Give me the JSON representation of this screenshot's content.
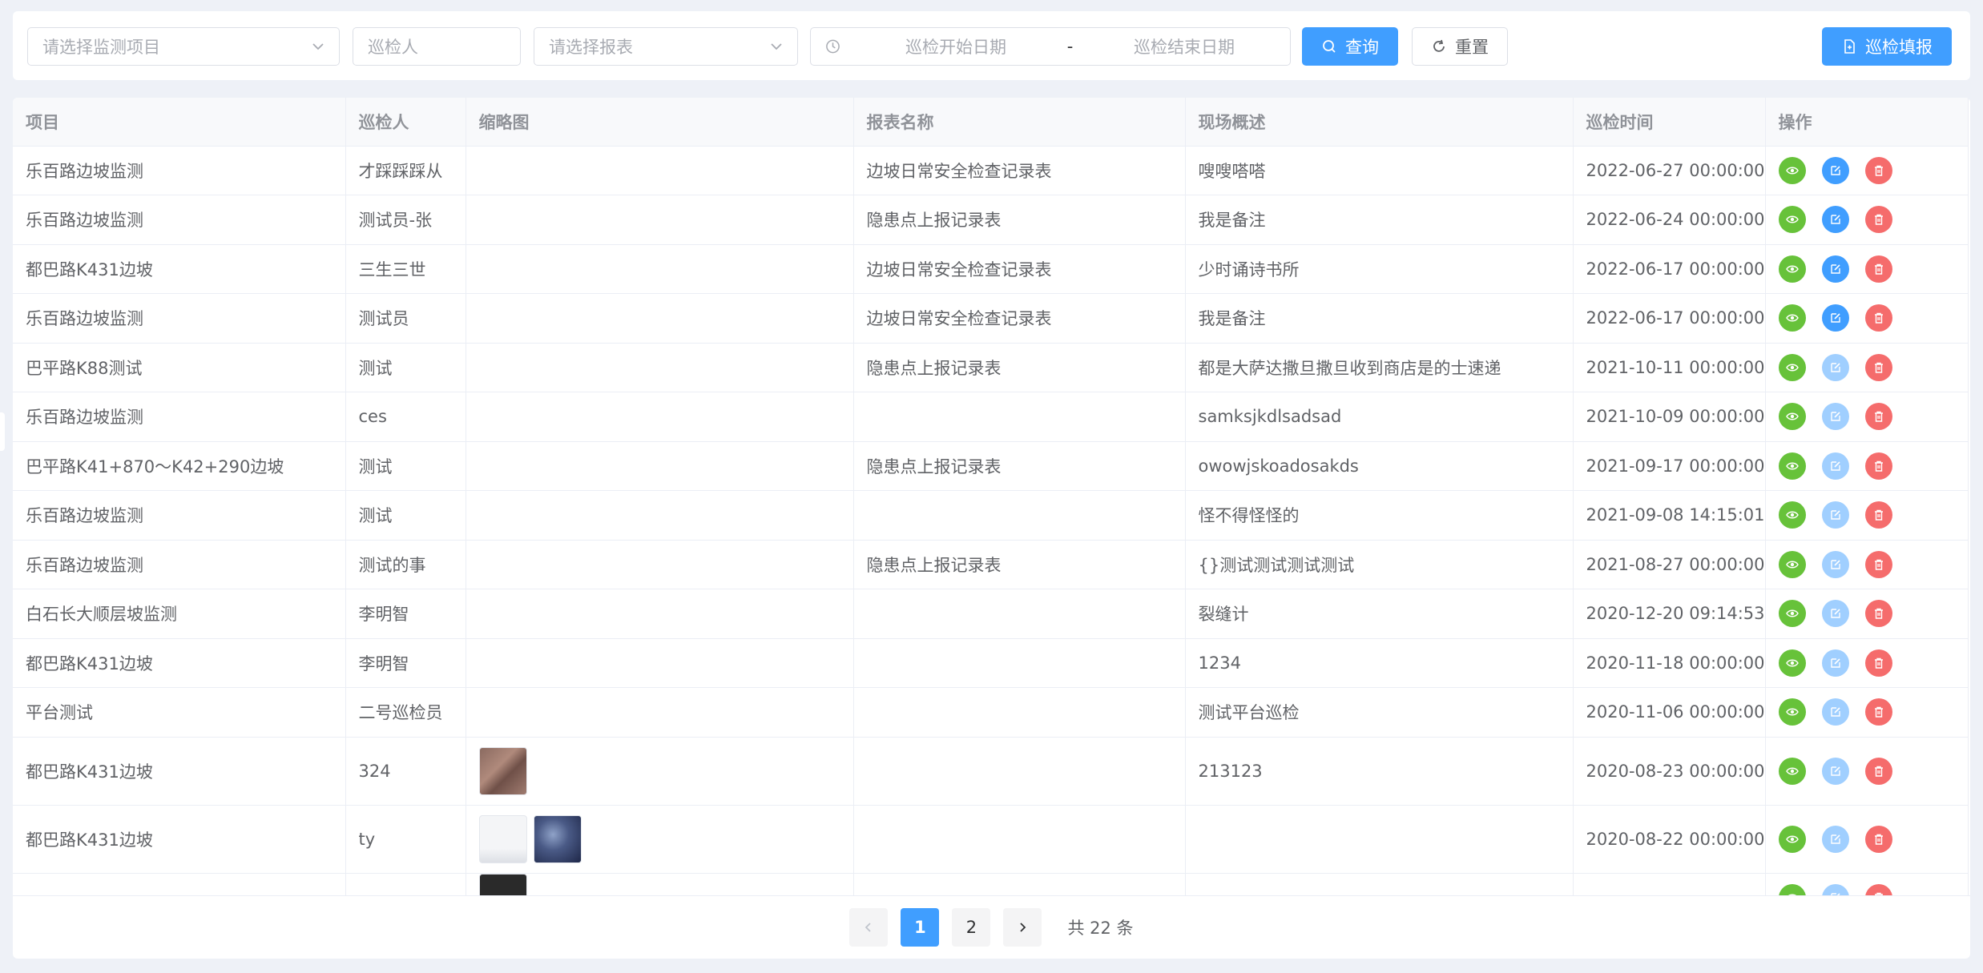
{
  "filters": {
    "project_placeholder": "请选择监测项目",
    "inspector_placeholder": "巡检人",
    "report_placeholder": "请选择报表",
    "start_date_placeholder": "巡检开始日期",
    "date_separator": "-",
    "end_date_placeholder": "巡检结束日期",
    "query_label": "查询",
    "reset_label": "重置",
    "fill_label": "巡检填报"
  },
  "table": {
    "columns": [
      "项目",
      "巡检人",
      "缩略图",
      "报表名称",
      "现场概述",
      "巡检时间",
      "操作"
    ],
    "rows": [
      {
        "project": "乐百路边坡监测",
        "inspector": "才踩踩踩从",
        "report": "边坡日常安全检查记录表",
        "summary": "嗖嗖嗒嗒",
        "time": "2022-06-27 00:00:00",
        "editable": true
      },
      {
        "project": "乐百路边坡监测",
        "inspector": "测试员-张",
        "report": "隐患点上报记录表",
        "summary": "我是备注",
        "time": "2022-06-24 00:00:00",
        "editable": true
      },
      {
        "project": "都巴路K431边坡",
        "inspector": "三生三世",
        "report": "边坡日常安全检查记录表",
        "summary": "少时诵诗书所",
        "time": "2022-06-17 00:00:00",
        "editable": true
      },
      {
        "project": "乐百路边坡监测",
        "inspector": "测试员",
        "report": "边坡日常安全检查记录表",
        "summary": "我是备注",
        "time": "2022-06-17 00:00:00",
        "editable": true
      },
      {
        "project": "巴平路K88测试",
        "inspector": "测试",
        "report": "隐患点上报记录表",
        "summary": "都是大萨达撒旦撒旦收到商店是的士速递",
        "time": "2021-10-11 00:00:00",
        "editable": false
      },
      {
        "project": "乐百路边坡监测",
        "inspector": "ces",
        "report": "",
        "summary": "samksjkdlsadsad",
        "time": "2021-10-09 00:00:00",
        "editable": false
      },
      {
        "project": "巴平路K41+870～K42+290边坡",
        "inspector": "测试",
        "report": "隐患点上报记录表",
        "summary": "owowjskoadosakds",
        "time": "2021-09-17 00:00:00",
        "editable": false
      },
      {
        "project": "乐百路边坡监测",
        "inspector": "测试",
        "report": "",
        "summary": "怪不得怪怪的",
        "time": "2021-09-08 14:15:01",
        "editable": false
      },
      {
        "project": "乐百路边坡监测",
        "inspector": "测试的事",
        "report": "隐患点上报记录表",
        "summary": "{}测试测试测试测试",
        "time": "2021-08-27 00:00:00",
        "editable": false
      },
      {
        "project": "白石长大顺层坡监测",
        "inspector": "李明智",
        "report": "",
        "summary": "裂缝计",
        "time": "2020-12-20 09:14:53",
        "editable": false
      },
      {
        "project": "都巴路K431边坡",
        "inspector": "李明智",
        "report": "",
        "summary": "1234",
        "time": "2020-11-18 00:00:00",
        "editable": false
      },
      {
        "project": "平台测试",
        "inspector": "二号巡检员",
        "report": "",
        "summary": "测试平台巡检",
        "time": "2020-11-06 00:00:00",
        "editable": false
      },
      {
        "project": "都巴路K431边坡",
        "inspector": "324",
        "report": "",
        "summary": "213123",
        "time": "2020-08-23 00:00:00",
        "editable": false,
        "thumbs": [
          "brown"
        ]
      },
      {
        "project": "都巴路K431边坡",
        "inspector": "ty",
        "report": "",
        "summary": "",
        "time": "2020-08-22 00:00:00",
        "editable": false,
        "thumbs": [
          "white",
          "space"
        ]
      }
    ]
  },
  "pagination": {
    "pages": [
      "1",
      "2"
    ],
    "current": "1",
    "total_text": "共 22 条"
  },
  "colors": {
    "primary": "#409eff",
    "view": "#67c23a",
    "edit": "#409eff",
    "edit_disabled": "#a0cfff",
    "delete": "#f56c6c"
  }
}
